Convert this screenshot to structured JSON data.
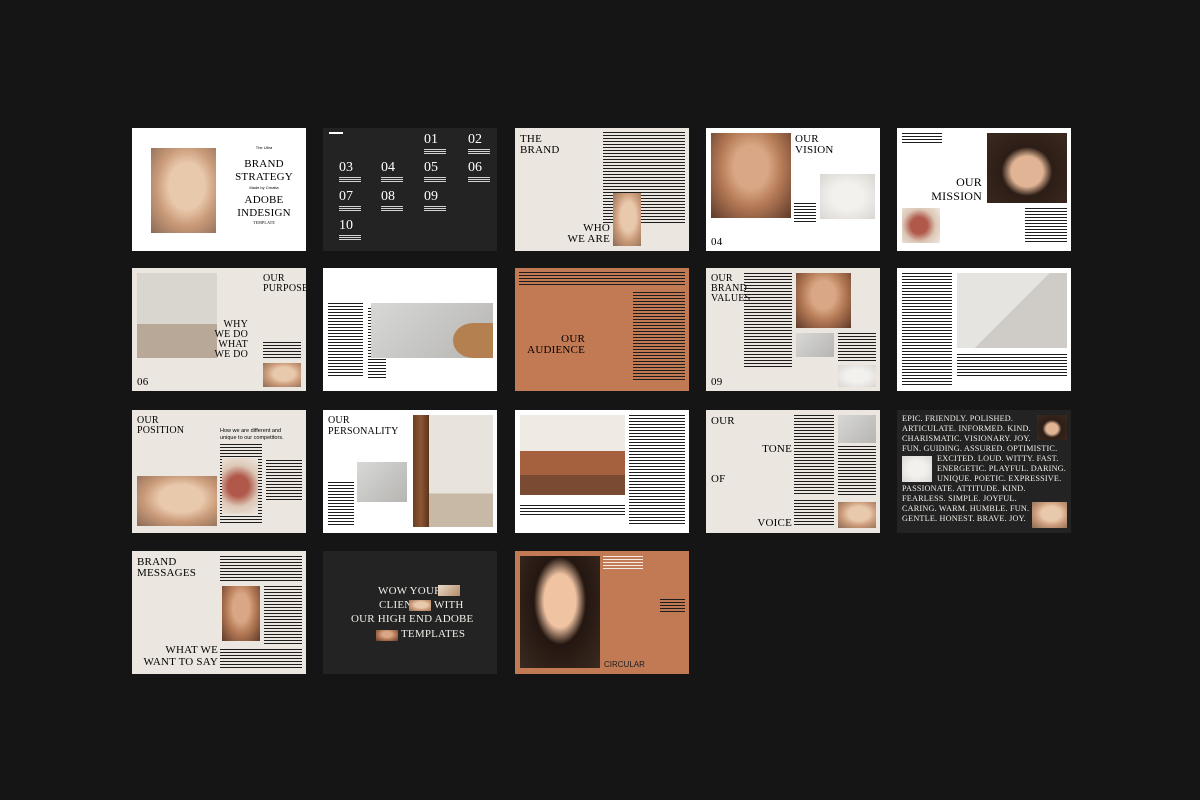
{
  "slide1": {
    "kicker": "The Ultra",
    "title_l1": "BRAND",
    "title_l2": "STRATEGY",
    "byline": "Made by Creatia",
    "title_l3": "ADOBE",
    "title_l4": "INDESIGN",
    "tag": "TEMPLATE"
  },
  "slide2": {
    "numbers": [
      "01",
      "02",
      "03",
      "04",
      "05",
      "06",
      "07",
      "08",
      "09",
      "10"
    ]
  },
  "slide3": {
    "top_l1": "THE",
    "top_l2": "BRAND",
    "bottom_l1": "WHO",
    "bottom_l2": "WE ARE"
  },
  "slide4": {
    "title_l1": "OUR",
    "title_l2": "VISION",
    "page": "04"
  },
  "slide5": {
    "title_l1": "OUR",
    "title_l2": "MISSION"
  },
  "slide6": {
    "title_l1": "OUR",
    "title_l2": "PURPOSE",
    "sub_l1": "WHY",
    "sub_l2": "WE DO",
    "sub_l3": "WHAT",
    "sub_l4": "WE DO",
    "page": "06"
  },
  "slide8": {
    "title_l1": "OUR",
    "title_l2": "AUDIENCE"
  },
  "slide9": {
    "title_l1": "OUR",
    "title_l2": "BRAND",
    "title_l3": "VALUES",
    "page": "09"
  },
  "slide11": {
    "title_l1": "OUR",
    "title_l2": "POSITION",
    "lead_l1": "How we are different and",
    "lead_l2": "unique to our competitors."
  },
  "slide12": {
    "title_l1": "OUR",
    "title_l2": "PERSONALITY"
  },
  "slide14": {
    "w1": "OUR",
    "w2": "TONE",
    "w3": "OF",
    "w4": "VOICE"
  },
  "slide15": {
    "lines": [
      "EPIC. FRIENDLY. POLISHED.",
      "ARTICULATE. INFORMED. KIND.",
      "CHARISMATIC. VISIONARY. JOY.",
      "FUN. GUIDING. ASSURED. OPTIMISTIC.",
      "EXCITED. LOUD. WITTY. FAST.",
      "ENERGETIC. PLAYFUL. DARING.",
      "UNIQUE. POETIC. EXPRESSIVE.",
      "PASSIONATE. ATTITUDE. KIND.",
      "FEARLESS. SIMPLE. JOYFUL.",
      "CARING. WARM. HUMBLE. FUN.",
      "GENTLE. HONEST. BRAVE. JOY."
    ]
  },
  "slide16": {
    "title_l1": "BRAND",
    "title_l2": "MESSAGES",
    "bottom_l1": "WHAT WE",
    "bottom_l2": "WANT TO SAY"
  },
  "slide17": {
    "l1": "WOW YOUR",
    "l2": "CLIENTS",
    "l2b": "WITH",
    "l3": "OUR HIGH END ADOBE",
    "l4": "TEMPLATES"
  },
  "slide18": {
    "label": "CIRCULAR"
  }
}
